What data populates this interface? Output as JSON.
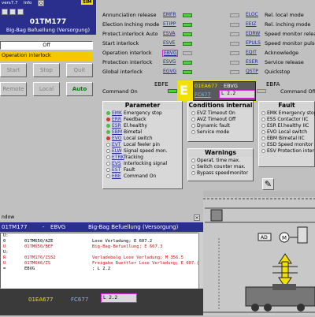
{
  "topbar": {
    "version": "vers7.7",
    "info": "Info",
    "q_label": "Q",
    "sim_label": "SIM",
    "buttons": [
      "",
      "",
      ""
    ]
  },
  "unit": {
    "code": "01TM177",
    "name": "Big-Bag Befuellung (Versorgung)"
  },
  "mode": {
    "value": "Off"
  },
  "message": {
    "interlock": "Operation interlock"
  },
  "controls": {
    "start": "Start",
    "stop": "Stop",
    "quit": "Quit",
    "remote": "Remote",
    "local": "Local",
    "auto": "Auto"
  },
  "signals_left": [
    {
      "label": "Annunciation release",
      "code": "EMFR",
      "on": true
    },
    {
      "label": "Election Inching mode",
      "code": "ETIPP",
      "on": true
    },
    {
      "label": "Protect.interlock Auto",
      "code": "ESVA",
      "on": true
    },
    {
      "label": "Start interlock",
      "code": "ESVE",
      "on": true
    },
    {
      "label": "Operation interlock",
      "code": "EBVG",
      "on": false
    },
    {
      "label": "Protection interlock",
      "code": "ESVG",
      "on": true
    },
    {
      "label": "Global interlock",
      "code": "EGVG",
      "on": true
    }
  ],
  "signals_right": [
    {
      "code": "ELOC",
      "label": "Rel. local mode",
      "on": false
    },
    {
      "code": "EEIZ",
      "label": "Rel. inching mode",
      "on": false
    },
    {
      "code": "EDRW",
      "label": "Speed monitor release",
      "on": false
    },
    {
      "code": "EPULS",
      "label": "Speed monitor pulse",
      "on": false
    },
    {
      "code": "EQIT",
      "label": "Acknowledge",
      "on": false
    },
    {
      "code": "ESER",
      "label": "Service release",
      "on": false
    },
    {
      "code": "QSTP",
      "label": "Quickstop",
      "on": false
    }
  ],
  "command": {
    "on_left": "Command On",
    "on_right": "Command Off",
    "ebfe": "EBFE",
    "ebfa": "EBFA",
    "e_letter": "E",
    "unit": "01EA677",
    "signal": "EBVG",
    "fc": "FC677",
    "value": "L    2.2"
  },
  "parameter": {
    "title": "Parameter",
    "rows": [
      {
        "code": "EMK",
        "label": "Emergency stop",
        "color": "g"
      },
      {
        "code": "ERR",
        "label": "Feedback",
        "color": "r"
      },
      {
        "code": "ESR",
        "label": "El.healthy",
        "color": "g"
      },
      {
        "code": "EBM",
        "label": "Bimetal",
        "color": "g"
      },
      {
        "code": "EVO",
        "label": "Local switch",
        "color": "r"
      },
      {
        "code": "EVT",
        "label": "Local feeler pin",
        "color": "w"
      },
      {
        "code": "ELW",
        "label": "Signal speed mon.",
        "color": "w"
      },
      {
        "code": "ETRK",
        "label": "Tracking",
        "color": "w"
      },
      {
        "code": "EVS",
        "label": "Interlocking signal",
        "color": "w"
      },
      {
        "code": "EST",
        "label": "Fault",
        "color": "w"
      },
      {
        "code": "EBE",
        "label": "Command On",
        "color": "w"
      }
    ]
  },
  "conditions": {
    "title": "Conditions internal",
    "rows": [
      "EVZ  Timeout On",
      "AVZ  Timeout Off",
      "Dynamic fault",
      "Service mode"
    ]
  },
  "warnings": {
    "title": "Warnings",
    "rows": [
      "Operat. time max.",
      "Switch counter max.",
      "Bypass speedmonitor"
    ]
  },
  "fault": {
    "title": "Fault",
    "rows": [
      "EMK  Emergency stop",
      "ESS  Contactor IIC",
      "ESR  El.healthy IIC",
      "EVO  Local switch",
      "EBM  Bimetal IIC",
      "ESD  Speed monitor",
      "ESV  Protection inter"
    ]
  },
  "window": {
    "title": "ndow",
    "head_code": "01TM177",
    "head_sep": "-",
    "head_signal": "EBVG",
    "head_name": "Big-Bag Befuellung (Versorgung)",
    "lines": [
      {
        "n": "U:",
        "a": "",
        "b": "",
        "red": false
      },
      {
        "n": "0",
        "a": "01TM650/AZE",
        "b": "Lose Verladung; E 607.2",
        "red": false
      },
      {
        "n": "U",
        "a": "01TM650/BEF",
        "b": "Big-Bag-Befuellung; E 607.3",
        "red": true
      },
      {
        "n": "U:",
        "a": "",
        "b": "",
        "red": false
      },
      {
        "n": "R",
        "a": "01TM176/ZS52",
        "b": "Verladebalg Lose Verladung; M 356.5",
        "red": true
      },
      {
        "n": "U",
        "a": "01TM646/ZS",
        "b": "Freigabe Ruettler Lose Verladung; E 607.(",
        "red": true
      },
      {
        "n": "=",
        "a": "EBVG",
        "b": "; L 2.2",
        "red": false
      }
    ],
    "foot_unit": "01EA677",
    "foot_fc": "FC677",
    "foot_value": "L    2.2"
  },
  "drawing": {
    "ad_label": "AD",
    "m_label": "M"
  }
}
